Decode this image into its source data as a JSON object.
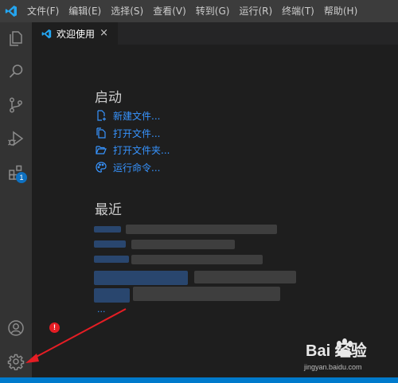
{
  "menubar": {
    "items": [
      "文件(F)",
      "编辑(E)",
      "选择(S)",
      "查看(V)",
      "转到(G)",
      "运行(R)",
      "终端(T)",
      "帮助(H)"
    ]
  },
  "activitybar": {
    "extensions_badge": "1"
  },
  "tab": {
    "label": "欢迎使用",
    "close": "×"
  },
  "welcome": {
    "start_title": "启动",
    "start_links": [
      "新建文件...",
      "打开文件...",
      "打开文件夹...",
      "运行命令..."
    ],
    "recent_title": "最近",
    "recent_more": "..."
  },
  "annotation": {
    "badge": "!"
  },
  "watermark": {
    "line1": "Bai 经验",
    "line2": "jingyan.baidu.com"
  },
  "colors": {
    "accent": "#007acc",
    "link": "#3794ff",
    "annotation": "#e51d24"
  }
}
